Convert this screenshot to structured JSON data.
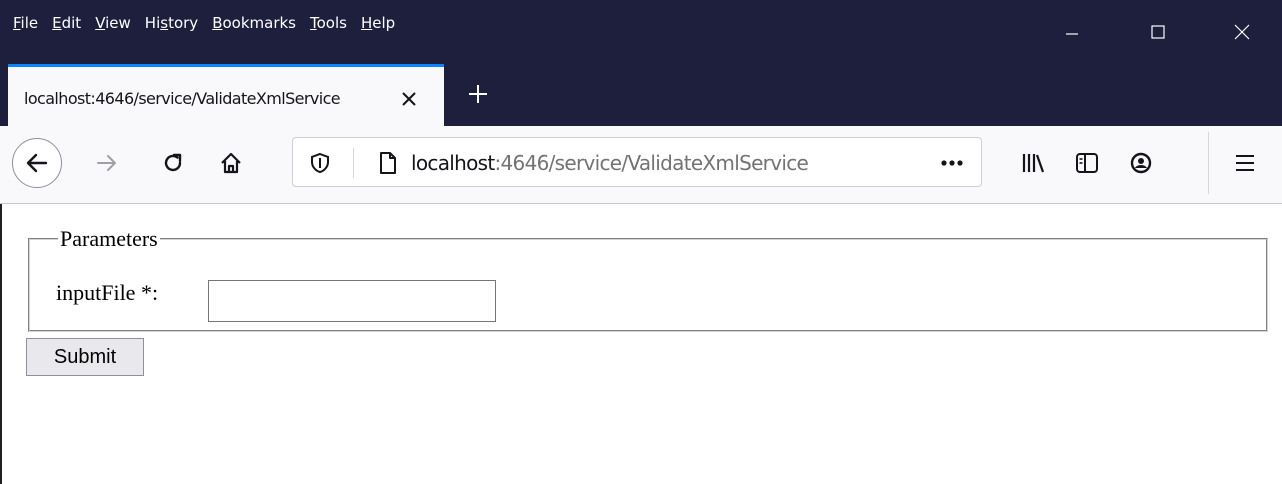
{
  "menu": [
    {
      "pre": "",
      "ul": "F",
      "post": "ile"
    },
    {
      "pre": "",
      "ul": "E",
      "post": "dit"
    },
    {
      "pre": "",
      "ul": "V",
      "post": "iew"
    },
    {
      "pre": "Hi",
      "ul": "s",
      "post": "tory"
    },
    {
      "pre": "",
      "ul": "B",
      "post": "ookmarks"
    },
    {
      "pre": "",
      "ul": "T",
      "post": "ools"
    },
    {
      "pre": "",
      "ul": "H",
      "post": "elp"
    }
  ],
  "tab": {
    "title": "localhost:4646/service/ValidateXmlService"
  },
  "urlbar": {
    "host": "localhost",
    "path": ":4646/service/ValidateXmlService"
  },
  "form": {
    "legend": "Parameters",
    "field_label": "inputFile *:",
    "field_value": "",
    "submit_label": "Submit"
  },
  "colors": {
    "titlebar": "#1e1f3d",
    "tab_accent": "#0a84ff",
    "toolbar": "#f9f9fb"
  }
}
